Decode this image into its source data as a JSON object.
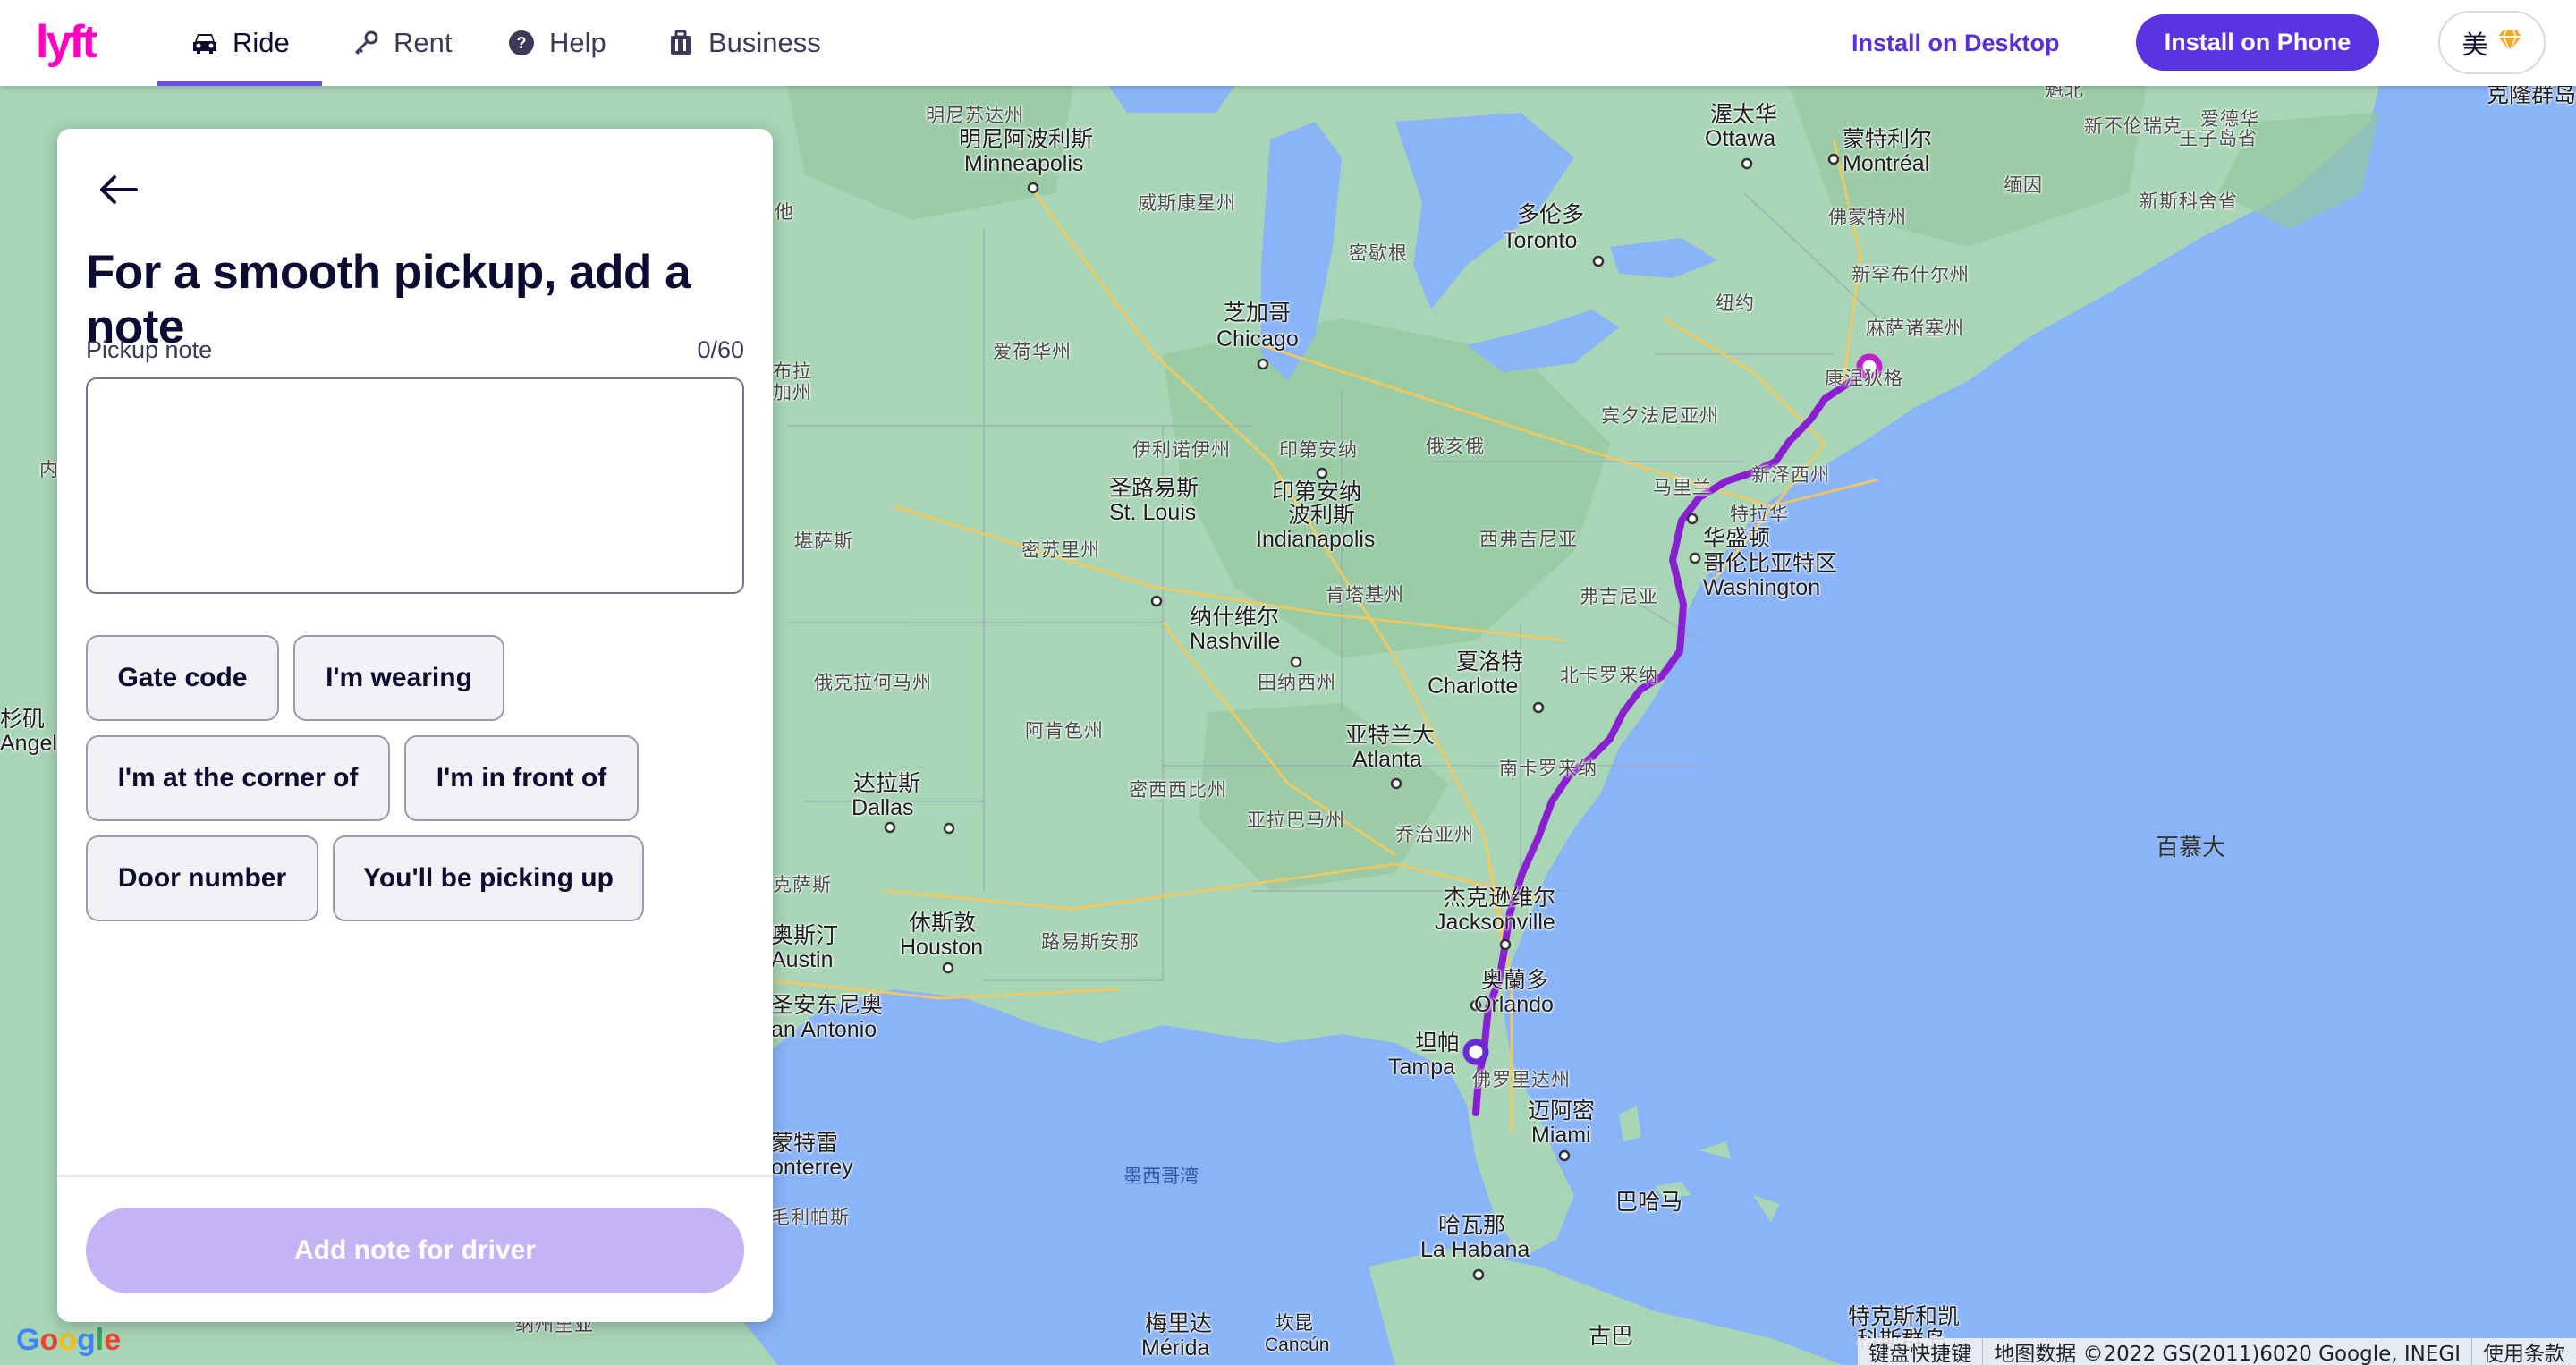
{
  "nav": {
    "brand": "lyft",
    "tabs": [
      {
        "label": "Ride",
        "icon": "car-icon",
        "active": true
      },
      {
        "label": "Rent",
        "icon": "key-icon",
        "active": false
      },
      {
        "label": "Help",
        "icon": "help-circle-icon",
        "active": false
      },
      {
        "label": "Business",
        "icon": "briefcase-icon",
        "active": false
      }
    ],
    "install_desktop": "Install on Desktop",
    "install_phone": "Install on Phone",
    "language": "美",
    "colors": {
      "accent": "#5c33e0",
      "brand": "#ff00bf"
    }
  },
  "panel": {
    "title": "For a smooth pickup, add a note",
    "note_label": "Pickup note",
    "note_counter": "0/60",
    "note_value": "",
    "chips": [
      "Gate code",
      "I'm wearing",
      "I'm at the corner of",
      "I'm in front of",
      "Door number",
      "You'll be picking up"
    ],
    "submit_label": "Add note for driver",
    "submit_color": "#c3b4f6"
  },
  "map": {
    "route_color": "#8a1fd1",
    "labels": {
      "minneapolis_zh": "明尼阿波利斯",
      "minneapolis": "Minneapolis",
      "minnesota": "明尼苏达州",
      "wisconsin": "威斯康星州",
      "michigan": "密歇根",
      "chicago_zh": "芝加哥",
      "chicago": "Chicago",
      "iowa": "爱荷华州",
      "illinois": "伊利诺伊州",
      "indiana": "印第安纳",
      "ohio": "俄亥俄",
      "stlouis_zh": "圣路易斯",
      "stlouis": "St. Louis",
      "indianapolis_zh1": "印第安纳",
      "indianapolis_zh2": "波利斯",
      "indianapolis": "Indianapolis",
      "missouri": "密苏里州",
      "kansas": "堪萨斯",
      "kentucky": "肯塔基州",
      "westvirginia": "西弗吉尼亚",
      "virginia": "弗吉尼亚",
      "pennsylvania": "宾夕法尼亚州",
      "newyork_state": "纽约",
      "ottawa_zh": "渥太华",
      "ottawa": "Ottawa",
      "montreal_zh": "蒙特利尔",
      "montreal": "Montréal",
      "toronto_zh": "多伦多",
      "toronto": "Toronto",
      "vermont": "佛蒙特州",
      "newhampshire": "新罕布什尔州",
      "massachusetts": "麻萨诸塞州",
      "connecticut": "康涅狄格",
      "maine": "缅因",
      "newbrunswick": "新不伦瑞克",
      "newjersey": "新泽西州",
      "maryland": "马里兰",
      "delaware": "特拉华",
      "washington_zh1": "华盛顿",
      "washington_zh2": "哥伦比亚特区",
      "washington": "Washington",
      "nashville_zh": "纳什维尔",
      "nashville": "Nashville",
      "tennessee": "田纳西州",
      "northcarolina": "北卡罗来纳",
      "charlotte_zh": "夏洛特",
      "charlotte": "Charlotte",
      "southcarolina": "南卡罗来纳",
      "atlanta_zh": "亚特兰大",
      "atlanta": "Atlanta",
      "georgia": "乔治亚州",
      "alabama": "亚拉巴马州",
      "mississippi": "密西西比州",
      "arkansas": "阿肯色州",
      "oklahoma": "俄克拉何马州",
      "dallas_zh": "达拉斯",
      "dallas": "Dallas",
      "texas": "克萨斯",
      "houston_zh": "休斯敦",
      "houston": "Houston",
      "austin_zh": "奥斯汀",
      "austin": "Austin",
      "sanantonio_zh": "圣安东尼奥",
      "sanantonio": "an Antonio",
      "louisiana": "路易斯安那",
      "jacksonville_zh": "杰克逊维尔",
      "jacksonville": "Jacksonville",
      "orlando_zh": "奥蘭多",
      "orlando": "Orlando",
      "tampa_zh": "坦帕",
      "tampa": "Tampa",
      "florida": "佛罗里达州",
      "miami_zh": "迈阿密",
      "miami": "Miami",
      "gulf": "墨西哥湾",
      "bahamas": "巴哈马",
      "havana_zh": "哈瓦那",
      "havana": "La Habana",
      "cuba": "古巴",
      "merida_zh": "梅里达",
      "merida": "Mérida",
      "cancun_zh": "坎昆",
      "cancun": "Cancún",
      "monterrey_zh": "蒙特雷",
      "monterrey": "onterrey",
      "tamaulipas": "毛利帕斯",
      "bermuda": "百慕大",
      "nebraska": "布拉",
      "nebraska2": "加州",
      "turks_caicos1": "特克斯和凯",
      "turks_caicos2": "科斯群岛",
      "nuevoleon": "纳州里亚",
      "pei1": "爱德华",
      "pei2": "王子岛省",
      "novascotia": "新斯科舍省",
      "quebec_ne": "魁北",
      "kroner": "克隆群岛",
      "la_zh": "杉矶",
      "la": "Angel",
      "kansas_west": "内",
      "wisconsin_west": "他"
    }
  },
  "attribution": {
    "google": "Google",
    "shortcuts": "键盘快捷键",
    "data": "地图数据 ©2022 GS(2011)6020 Google, INEGI",
    "terms": "使用条款"
  }
}
